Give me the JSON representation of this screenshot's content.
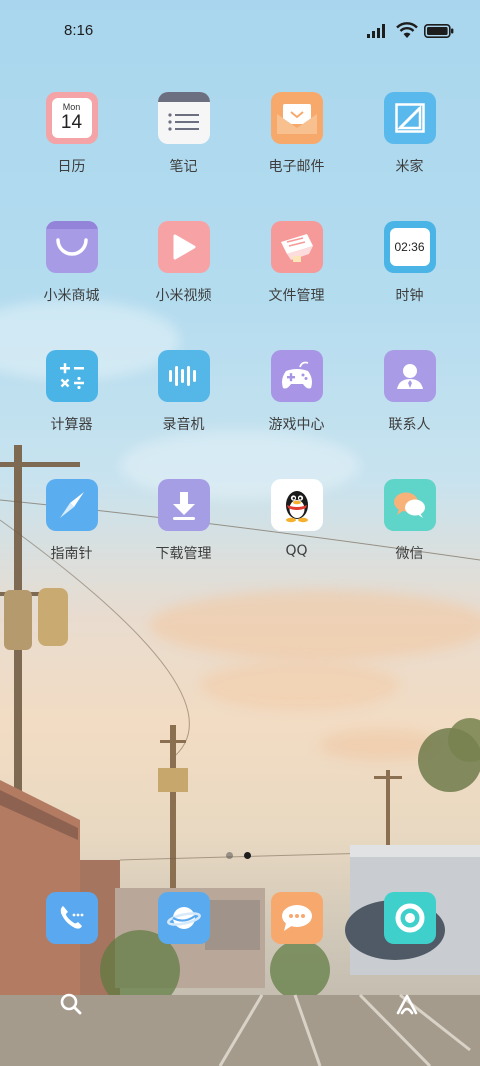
{
  "status_bar": {
    "time": "8:16"
  },
  "apps": [
    {
      "label": "日历",
      "icon": "calendar-icon",
      "month": "Mon",
      "day": "14"
    },
    {
      "label": "笔记",
      "icon": "notes-icon"
    },
    {
      "label": "电子邮件",
      "icon": "mail-icon"
    },
    {
      "label": "米家",
      "icon": "mijia-icon"
    },
    {
      "label": "小米商城",
      "icon": "shop-bag-icon"
    },
    {
      "label": "小米视频",
      "icon": "video-play-icon"
    },
    {
      "label": "文件管理",
      "icon": "file-manager-icon"
    },
    {
      "label": "时钟",
      "icon": "clock-icon",
      "clock_time": "02:36"
    },
    {
      "label": "计算器",
      "icon": "calculator-icon"
    },
    {
      "label": "录音机",
      "icon": "recorder-icon"
    },
    {
      "label": "游戏中心",
      "icon": "gamepad-icon"
    },
    {
      "label": "联系人",
      "icon": "contact-icon"
    },
    {
      "label": "指南针",
      "icon": "compass-icon"
    },
    {
      "label": "下载管理",
      "icon": "download-icon"
    },
    {
      "label": "QQ",
      "icon": "qq-penguin-icon"
    },
    {
      "label": "微信",
      "icon": "wechat-icon"
    }
  ],
  "dock": [
    {
      "icon": "phone-icon"
    },
    {
      "icon": "browser-planet-icon"
    },
    {
      "icon": "messages-icon"
    },
    {
      "icon": "camera-icon"
    }
  ],
  "page_indicator": {
    "pages": 2,
    "current": 2
  },
  "colors": {
    "calendar": "#f4a3a6",
    "notes": "#f6f6f6",
    "mail": "#f7a96c",
    "mijia": "#5ab9ec",
    "shop": "#a89be6",
    "video": "#f7a3a6",
    "files": "#f59a99",
    "clock": "#4ab4e6",
    "calc": "#4ab4e6",
    "recorder": "#55b6e8",
    "game": "#a895e5",
    "contacts": "#a99be6",
    "compass": "#5aaef0",
    "download": "#a69ee5",
    "qq": "#ffffff",
    "wechat": "#5fd4c8",
    "phone": "#5aa9f0",
    "browser": "#5aaaf0",
    "messages": "#f7a86d",
    "camera": "#3fd0cc"
  }
}
